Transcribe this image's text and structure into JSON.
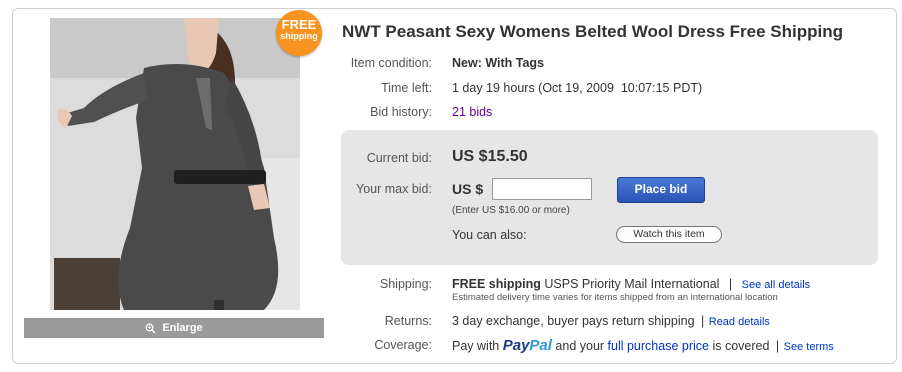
{
  "listing": {
    "title": "NWT Peasant Sexy Womens Belted Wool Dress Free Shipping",
    "badge": {
      "line1": "FREE",
      "line2": "shipping"
    },
    "enlarge_label": "Enlarge",
    "item_condition": {
      "label": "Item condition:",
      "value": "New: With Tags"
    },
    "time_left": {
      "label": "Time left:",
      "value": "1 day 19 hours (Oct 19, 2009  10:07:15 PDT)"
    },
    "bid_history": {
      "label": "Bid history:",
      "value": "21 bids"
    }
  },
  "bid": {
    "current_label": "Current bid:",
    "current_value": "US $15.50",
    "max_label": "Your max bid:",
    "currency_prefix": "US $",
    "input_value": "",
    "place_bid_label": "Place bid",
    "hint": "(Enter US $16.00 or more)",
    "also_label": "You can also:",
    "watch_label": "Watch this item"
  },
  "shipping": {
    "label": "Shipping:",
    "free": "FREE shipping",
    "service": " USPS Priority Mail International",
    "sep": "|",
    "link": "See all details",
    "note": "Estimated delivery time varies for items shipped from an international location"
  },
  "returns": {
    "label": "Returns:",
    "value": "3 day exchange, buyer pays return shipping",
    "sep": "|",
    "link": "Read details"
  },
  "coverage": {
    "label": "Coverage:",
    "pre": "Pay with ",
    "paypal_1": "Pay",
    "paypal_2": "Pal",
    "mid": " and your ",
    "link": "full purchase price",
    "post": " is covered",
    "sep": "|",
    "terms": "See terms"
  },
  "colors": {
    "accent": "#f7931e",
    "link": "#0033cc",
    "visited": "#660099",
    "button": "#3a66c8"
  }
}
